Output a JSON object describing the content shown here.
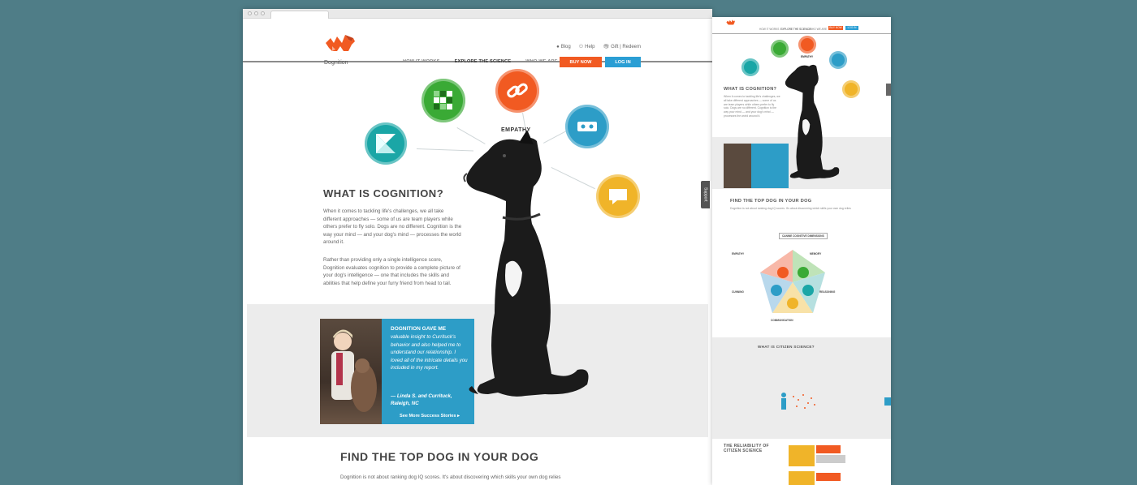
{
  "logo": {
    "word": "Dognition"
  },
  "util": {
    "blog": "Blog",
    "help": "Help",
    "gift": "Gift | Redeem"
  },
  "nav": {
    "how": "HOW IT WORKS",
    "explore": "EXPLORE THE SCIENCE",
    "who": "WHO WE ARE"
  },
  "buttons": {
    "buy": "BUY NOW",
    "login": "LOG IN"
  },
  "hero": {
    "empathy": "EMPATHY",
    "title": "WHAT IS COGNITION?",
    "p1": "When it comes to tackling life's challenges, we all take different approaches — some of us are team players while others prefer to fly solo. Dogs are no different. Cognition is the way your mind — and your dog's mind — processes the world around it.",
    "p2": "Rather than providing only a single intelligence score, Dognition evaluates cognition to provide a complete picture of your dog's intelligence — one that includes the skills and abilities that help define your furry friend from head to tail."
  },
  "testimonial": {
    "heading": "DOGNITION GAVE ME",
    "body": "valuable insight to Currituck's behavior and also helped me to understand our relationship. I loved all of the intricate details you included in my report.",
    "author": "— Linda S. and Currituck, Raleigh, NC",
    "more": "See More Success Stories ▸"
  },
  "find": {
    "title": "FIND THE TOP DOG IN YOUR DOG",
    "p": "Dognition is not about ranking dog IQ scores. It's about discovering which skills your own dog relies"
  },
  "support": "Support",
  "mobile": {
    "title1": "WHAT IS COGNITION?",
    "empathy": "EMPATHY",
    "find": "FIND THE TOP DOG IN YOUR DOG",
    "dims": "CANINE COGNITIVE DIMENSIONS",
    "d_empathy": "EMPATHY",
    "d_memory": "MEMORY",
    "d_cunning": "CUNNING",
    "d_reasoning": "REASONING",
    "d_communication": "COMMUNICATION",
    "citizen": "WHAT IS CITIZEN SCIENCE?",
    "reliability": "THE RELIABILITY OF CITIZEN SCIENCE",
    "buy": "BUY NOW",
    "login": "LOG IN"
  },
  "colors": {
    "orange": "#f15a22",
    "blue": "#2d9dc7",
    "green": "#3aaa35",
    "teal": "#1aa6a6",
    "yellow": "#f0b429",
    "bg": "#4f7d87"
  }
}
